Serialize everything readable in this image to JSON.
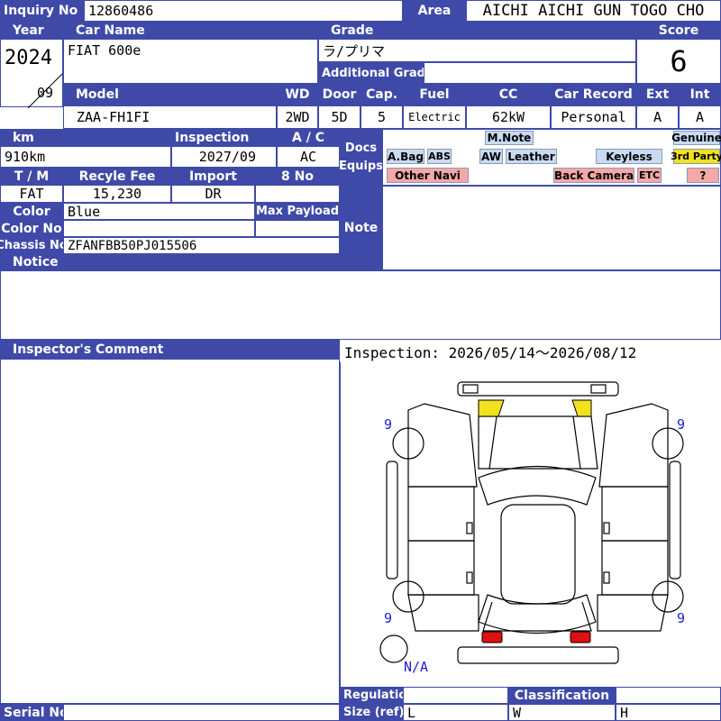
{
  "labels": {
    "inquiry_no": "Inquiry No",
    "area": "Area",
    "year": "Year",
    "car_name": "Car Name",
    "grade": "Grade",
    "score": "Score",
    "additional_grade": "Additional Grade",
    "model": "Model",
    "wd": "WD",
    "door": "Door",
    "cap": "Cap.",
    "fuel": "Fuel",
    "cc": "CC",
    "car_record": "Car Record",
    "ext": "Ext",
    "int": "Int",
    "km": "km",
    "inspection": "Inspection",
    "ac": "A / C",
    "docs": "Docs",
    "equips": "Equips",
    "tm": "T / M",
    "recycle_fee": "Recyle Fee",
    "import": "Import",
    "eight_no": "8 No",
    "color": "Color",
    "max_payload": "Max Payload",
    "color_no": "Color No",
    "chassis_no": "Chassis No",
    "note": "Note",
    "notice": "Notice",
    "inspector_comment": "Inspector's Comment",
    "regulation": "Regulation",
    "classification": "Classification",
    "size_ref": "Size (ref)",
    "serial_no": "Serial No",
    "l": "L",
    "w": "W",
    "h": "H"
  },
  "values": {
    "inquiry_no": "12860486",
    "area": "AICHI AICHI GUN TOGO CHO",
    "year": "2024",
    "month": "09",
    "car_name": "FIAT 600e",
    "grade": "ラ/プリマ",
    "score": "6",
    "model": "ZAA-FH1FI",
    "wd": "2WD",
    "door": "5D",
    "cap": "5",
    "fuel": "Electric",
    "cc": "62kW",
    "car_record": "Personal",
    "ext": "A",
    "int": "A",
    "km": "910km",
    "inspection": "2027/09",
    "ac": "AC",
    "tm": "FAT",
    "recycle_fee": "15,230",
    "import": "DR",
    "color": "Blue",
    "chassis_no": "ZFANFBB50PJ015506",
    "inspection_period": "Inspection: 2026/05/14～2026/08/12"
  },
  "equips": {
    "m_note": "M.Note",
    "genuine": "Genuine",
    "abag": "A.Bag",
    "abs": "ABS",
    "aw": "AW",
    "leather": "Leather",
    "keyless": "Keyless",
    "third_party": "3rd Party",
    "other_navi": "Other Navi",
    "back_camera": "Back Camera",
    "etc": "ETC",
    "unknown": "?"
  },
  "diagram": {
    "tire_tl": "9",
    "tire_tr": "9",
    "tire_bl": "9",
    "tire_br": "9",
    "spare": "N/A",
    "colors": {
      "headlight": "#f1e21d",
      "taillight": "#e01010"
    }
  },
  "colors": {
    "header_bg": "#3f4aa8",
    "equip_blue": "#c9daf2",
    "equip_red": "#f4a8a8",
    "equip_yellow": "#f1e21d"
  }
}
